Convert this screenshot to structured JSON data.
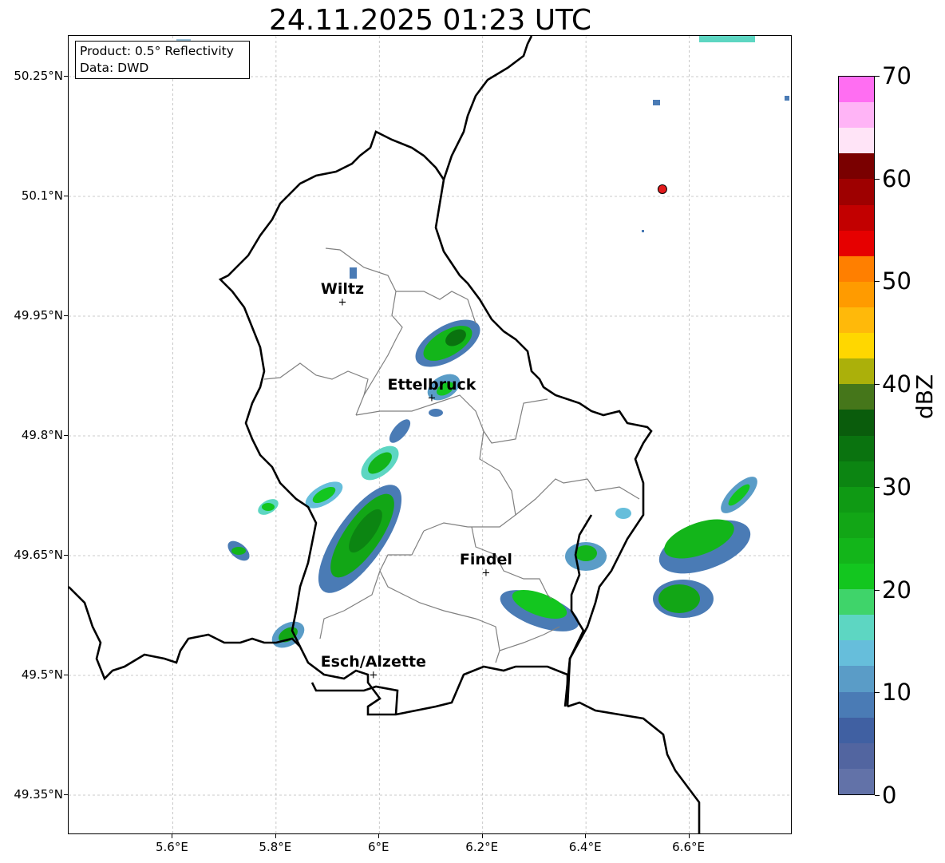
{
  "title": "24.11.2025 01:23 UTC",
  "info": {
    "product": "Product: 0.5° Reflectivity",
    "data": "Data: DWD"
  },
  "map": {
    "lon_range": [
      5.4,
      6.8
    ],
    "lat_range": [
      49.3,
      50.3
    ],
    "lat_ticks": [
      {
        "value": 50.25,
        "label": "50.25°N"
      },
      {
        "value": 50.1,
        "label": "50.1°N"
      },
      {
        "value": 49.95,
        "label": "49.95°N"
      },
      {
        "value": 49.8,
        "label": "49.8°N"
      },
      {
        "value": 49.65,
        "label": "49.65°N"
      },
      {
        "value": 49.5,
        "label": "49.5°N"
      },
      {
        "value": 49.35,
        "label": "49.35°N"
      }
    ],
    "lon_ticks": [
      {
        "value": 5.6,
        "label": "5.6°E"
      },
      {
        "value": 5.8,
        "label": "5.8°E"
      },
      {
        "value": 6.0,
        "label": "6°E"
      },
      {
        "value": 6.2,
        "label": "6.2°E"
      },
      {
        "value": 6.4,
        "label": "6.4°E"
      },
      {
        "value": 6.6,
        "label": "6.6°E"
      }
    ],
    "grid": true,
    "cities": [
      {
        "name": "Wiltz",
        "lon": 5.93,
        "lat": 49.966
      },
      {
        "name": "Ettelbruck",
        "lon": 6.103,
        "lat": 49.846
      },
      {
        "name": "Findel",
        "lon": 6.208,
        "lat": 49.627
      },
      {
        "name": "Esch/Alzette",
        "lon": 5.99,
        "lat": 49.499
      }
    ],
    "radar_site": {
      "lon": 6.548,
      "lat": 50.109,
      "color": "#e31a1c"
    }
  },
  "colorbar": {
    "label": "dBZ",
    "min": 0,
    "max": 70,
    "step": 2.5,
    "tick_values": [
      0,
      10,
      20,
      30,
      40,
      50,
      60,
      70
    ],
    "tick_labels": [
      "0",
      "10",
      "20",
      "30",
      "40",
      "50",
      "60",
      "70"
    ],
    "colors": [
      "#6272a8",
      "#5265a0",
      "#4060a2",
      "#4a7bb5",
      "#5a9cc7",
      "#66bedb",
      "#5dd6c2",
      "#3fd46a",
      "#13c61f",
      "#13b51a",
      "#12a616",
      "#0f9a14",
      "#0c8512",
      "#0a730f",
      "#0a5c0c",
      "#45761a",
      "#abb00a",
      "#ffd700",
      "#ffb90a",
      "#ff9b00",
      "#ff7f00",
      "#e60000",
      "#c20000",
      "#9e0000",
      "#7a0000",
      "#ffe4f7",
      "#ffb4f6",
      "#ff6ef2",
      "#e936e8"
    ]
  }
}
